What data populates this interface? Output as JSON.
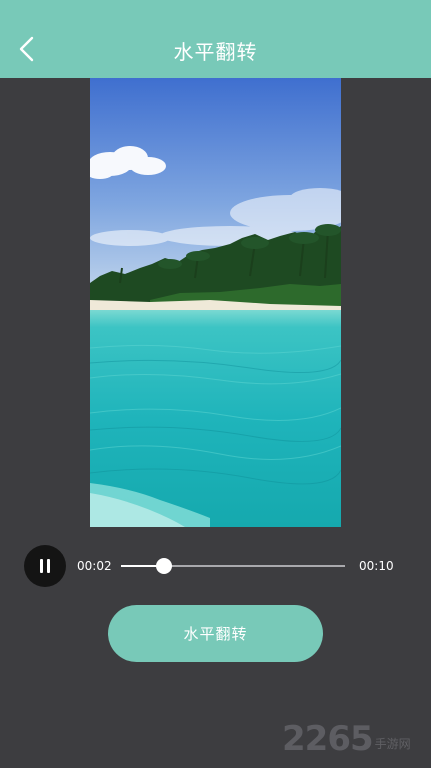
{
  "header": {
    "title": "水平翻转",
    "back_icon": "chevron-left-icon",
    "background": "#78c9b8"
  },
  "player": {
    "play_state_icon": "pause-icon",
    "current_time": "00:02",
    "total_time": "00:10",
    "progress_fraction": 0.19
  },
  "action": {
    "label": "水平翻转",
    "color": "#78c9b8"
  },
  "watermark": {
    "number": "2265",
    "suffix": "手游网"
  }
}
